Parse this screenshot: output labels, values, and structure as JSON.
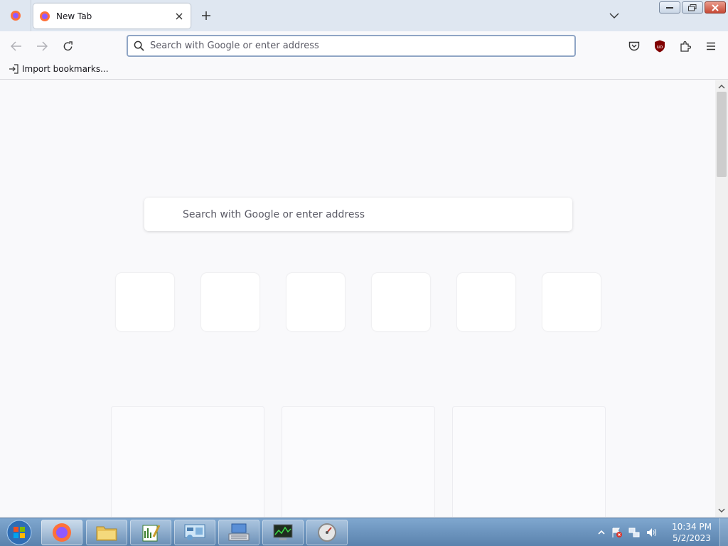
{
  "tab": {
    "title": "New Tab"
  },
  "urlbar": {
    "placeholder": "Search with Google or enter address"
  },
  "bookmarks": {
    "import_label": "Import bookmarks..."
  },
  "newtab": {
    "search_placeholder": "Search with Google or enter address",
    "top_sites_count": 6,
    "story_cards_count": 3
  },
  "taskbar": {
    "items": [
      "firefox",
      "file-explorer",
      "notepad-editor",
      "control-panel",
      "keyboard-settings",
      "task-manager",
      "gauge-utility"
    ],
    "clock_time": "10:34 PM",
    "clock_date": "5/2/2023"
  },
  "colors": {
    "accent": "#8fa5c5",
    "ublock": "#800000",
    "firefox_orange": "#ff7139"
  }
}
